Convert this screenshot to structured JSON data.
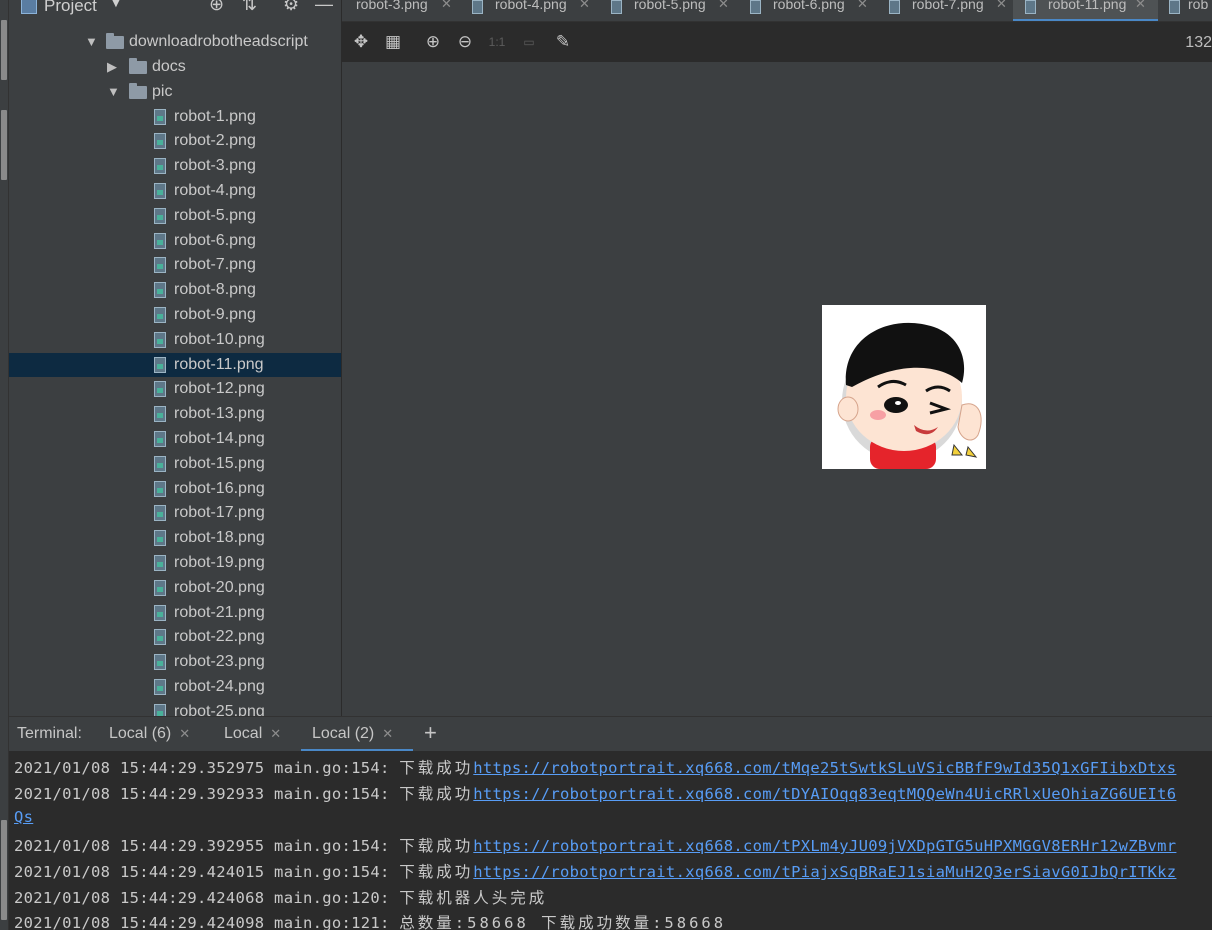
{
  "project_panel": {
    "title": "Project",
    "caret": "▼",
    "root_folder": "downloadrobotheadscript",
    "folders": [
      {
        "name": "docs",
        "expanded": false
      },
      {
        "name": "pic",
        "expanded": true
      }
    ],
    "files": [
      "robot-1.png",
      "robot-2.png",
      "robot-3.png",
      "robot-4.png",
      "robot-5.png",
      "robot-6.png",
      "robot-7.png",
      "robot-8.png",
      "robot-9.png",
      "robot-10.png",
      "robot-11.png",
      "robot-12.png",
      "robot-13.png",
      "robot-14.png",
      "robot-15.png",
      "robot-16.png",
      "robot-17.png",
      "robot-18.png",
      "robot-19.png",
      "robot-20.png",
      "robot-21.png",
      "robot-22.png",
      "robot-23.png",
      "robot-24.png",
      "robot-25.png"
    ],
    "selected_file": "robot-11.png"
  },
  "editor_tabs": [
    {
      "label": "robot-3.png",
      "active": false
    },
    {
      "label": "robot-4.png",
      "active": false
    },
    {
      "label": "robot-5.png",
      "active": false
    },
    {
      "label": "robot-6.png",
      "active": false
    },
    {
      "label": "robot-7.png",
      "active": false
    },
    {
      "label": "robot-11.png",
      "active": true
    },
    {
      "label": "rob",
      "active": false
    }
  ],
  "image_toolbar": {
    "actual_size_label": "1:1",
    "readout": "132"
  },
  "terminal": {
    "label": "Terminal:",
    "tabs": [
      {
        "label": "Local (6)",
        "active": false
      },
      {
        "label": "Local",
        "active": false
      },
      {
        "label": "Local (2)",
        "active": true
      }
    ],
    "add_label": "+",
    "lines": [
      {
        "prefix": "2021/01/08 15:44:29.352975 main.go:154: ",
        "cjk": "下载成功",
        "link": "https://robotportrait.xq668.com/tMqe25tSwtkSLuVSicBBfF9wId35Q1xGFIibxDtxs"
      },
      {
        "prefix": "2021/01/08 15:44:29.392933 main.go:154: ",
        "cjk": "下载成功",
        "link": "https://robotportrait.xq668.com/tDYAIOqq83eqtMQQeWn4UicRRlxUeOhiaZG6UEIt6"
      },
      {
        "prefix": "",
        "cjk": "",
        "link": "Qs"
      },
      {
        "prefix": "2021/01/08 15:44:29.392955 main.go:154: ",
        "cjk": "下载成功",
        "link": "https://robotportrait.xq668.com/tPXLm4yJU09jVXDpGTG5uHPXMGGV8ERHr12wZBvmr"
      },
      {
        "prefix": "2021/01/08 15:44:29.424015 main.go:154: ",
        "cjk": "下载成功",
        "link": "https://robotportrait.xq668.com/tPiajxSqBRaEJ1siaMuH2Q3erSiavG0IJbQrITKkz"
      },
      {
        "prefix": "2021/01/08 15:44:29.424068 main.go:120: ",
        "cjk": "下载机器人头完成",
        "link": ""
      },
      {
        "prefix": "2021/01/08 15:44:29.424098 main.go:121: ",
        "cjk": "总数量:58668  下载成功数量:58668",
        "link": ""
      }
    ]
  },
  "colors": {
    "selection": "#0d2a41",
    "link": "#589df6",
    "active_tab_underline": "#4a88c7"
  }
}
